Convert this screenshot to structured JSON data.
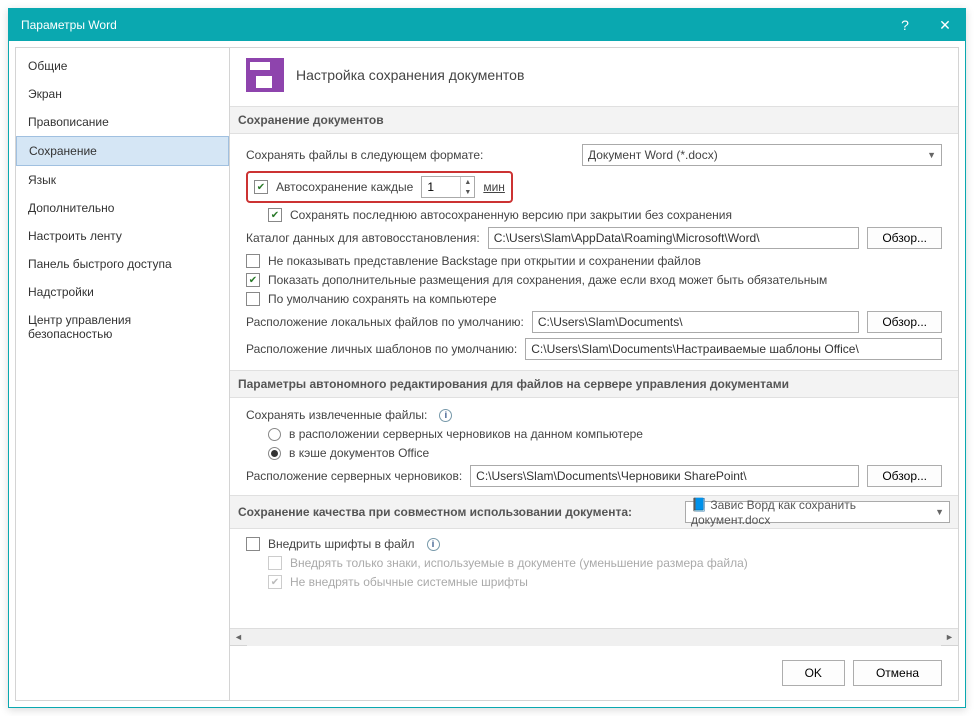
{
  "window": {
    "title": "Параметры Word"
  },
  "sidebar": {
    "items": [
      {
        "label": "Общие"
      },
      {
        "label": "Экран"
      },
      {
        "label": "Правописание"
      },
      {
        "label": "Сохранение"
      },
      {
        "label": "Язык"
      },
      {
        "label": "Дополнительно"
      },
      {
        "label": "Настроить ленту"
      },
      {
        "label": "Панель быстрого доступа"
      },
      {
        "label": "Надстройки"
      },
      {
        "label": "Центр управления безопасностью"
      }
    ],
    "activeIndex": 3
  },
  "page": {
    "title": "Настройка сохранения документов"
  },
  "sections": {
    "save_docs": {
      "header": "Сохранение документов",
      "format_label": "Сохранять файлы в следующем формате:",
      "format_value": "Документ Word (*.docx)",
      "autosave_label": "Автосохранение каждые",
      "autosave_value": "1",
      "autosave_unit": "мин",
      "keep_last_label": "Сохранять последнюю автосохраненную версию при закрытии без сохранения",
      "autorecover_loc_label": "Каталог данных для автовосстановления:",
      "autorecover_path": "C:\\Users\\Slam\\AppData\\Roaming\\Microsoft\\Word\\",
      "no_backstage_label": "Не показывать представление Backstage при открытии и сохранении файлов",
      "show_additional_label": "Показать дополнительные размещения для сохранения, даже если вход может быть обязательным",
      "save_to_computer_label": "По умолчанию сохранять на компьютере",
      "local_files_label": "Расположение локальных файлов по умолчанию:",
      "local_files_path": "C:\\Users\\Slam\\Documents\\",
      "templates_label": "Расположение личных шаблонов по умолчанию:",
      "templates_path": "C:\\Users\\Slam\\Documents\\Настраиваемые шаблоны Office\\"
    },
    "offline": {
      "header": "Параметры автономного редактирования для файлов на сервере управления документами",
      "checkout_label": "Сохранять извлеченные файлы:",
      "opt_server_drafts": "в расположении серверных черновиков на данном компьютере",
      "opt_office_cache": "в кэше документов Office",
      "drafts_label": "Расположение серверных черновиков:",
      "drafts_path": "C:\\Users\\Slam\\Documents\\Черновики SharePoint\\"
    },
    "fidelity": {
      "header": "Сохранение качества при совместном использовании документа:",
      "doc_name": "Завис Ворд как сохранить документ.docx",
      "embed_fonts_label": "Внедрить шрифты в файл",
      "embed_chars_label": "Внедрять только знаки, используемые в документе (уменьшение размера файла)",
      "no_system_fonts_label": "Не внедрять обычные системные шрифты"
    }
  },
  "buttons": {
    "browse": "Обзор...",
    "ok": "OK",
    "cancel": "Отмена"
  }
}
